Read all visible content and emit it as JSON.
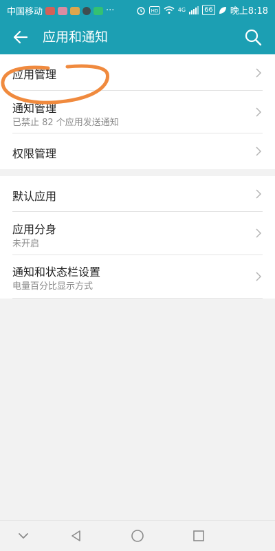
{
  "status_bar": {
    "carrier": "中国移动",
    "more": "···",
    "signal_label": "4G",
    "battery": "66",
    "time": "晚上8:18"
  },
  "toolbar": {
    "title": "应用和通知",
    "back_icon": "arrow-left-icon",
    "search_icon": "search-icon",
    "background_color": "#1c9fb3"
  },
  "section1": {
    "items": [
      {
        "title": "应用管理",
        "subtitle": ""
      },
      {
        "title": "通知管理",
        "subtitle": "已禁止 82 个应用发送通知"
      },
      {
        "title": "权限管理",
        "subtitle": ""
      }
    ]
  },
  "section2": {
    "items": [
      {
        "title": "默认应用",
        "subtitle": ""
      },
      {
        "title": "应用分身",
        "subtitle": "未开启"
      },
      {
        "title": "通知和状态栏设置",
        "subtitle": "电量百分比显示方式"
      }
    ]
  },
  "annotation": {
    "shape": "hand-drawn orange circle around 应用管理",
    "color": "#f08a3e"
  },
  "nav_bar": {
    "buttons": [
      "chevron-down-icon",
      "back-triangle-icon",
      "home-circle-icon",
      "recents-square-icon"
    ]
  }
}
